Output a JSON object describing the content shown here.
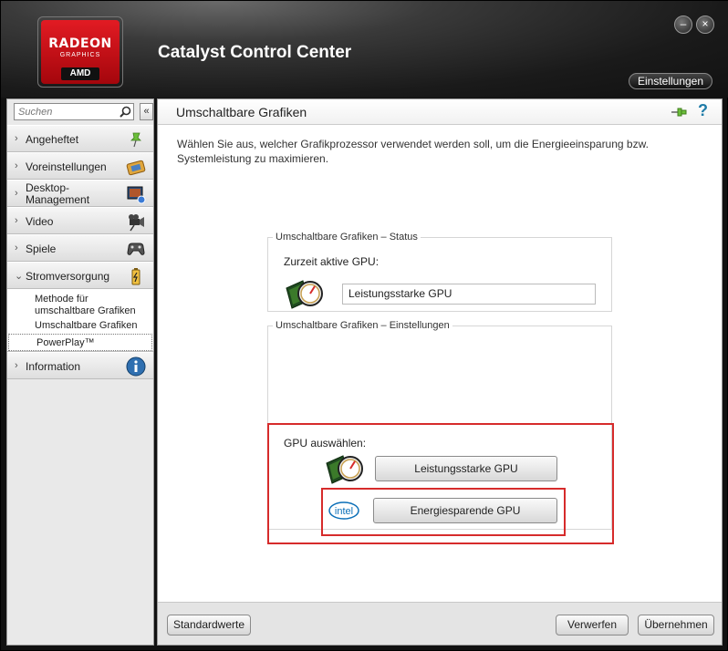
{
  "window": {
    "title": "Catalyst Control Center",
    "settings_label": "Einstellungen",
    "min_glyph": "–",
    "close_glyph": "×"
  },
  "logo": {
    "brand": "RADEON",
    "sub": "GRAPHICS",
    "maker": "AMD"
  },
  "sidebar": {
    "search_placeholder": "Suchen",
    "collapse_glyph": "«",
    "items": [
      {
        "label": "Angeheftet",
        "icon": "pin-icon"
      },
      {
        "label": "Voreinstellungen",
        "icon": "presets-icon"
      },
      {
        "label": "Desktop-\nManagement",
        "icon": "desktop-icon"
      },
      {
        "label": "Video",
        "icon": "video-camera-icon"
      },
      {
        "label": "Spiele",
        "icon": "gamepad-icon"
      },
      {
        "label": "Stromversorgung",
        "icon": "battery-icon",
        "expanded": true
      },
      {
        "label": "Information",
        "icon": "info-icon"
      }
    ],
    "subitems": [
      {
        "label": "Methode für umschaltbare Grafiken"
      },
      {
        "label": "Umschaltbare Grafiken"
      },
      {
        "label": "PowerPlay™"
      }
    ]
  },
  "main": {
    "title": "Umschaltbare Grafiken",
    "description": "Wählen Sie aus, welcher Grafikprozessor verwendet werden soll, um die Energieeinsparung bzw. Systemleistung zu maximieren.",
    "status": {
      "legend": "Umschaltbare Grafiken – Status",
      "active_label": "Zurzeit aktive GPU:",
      "active_value": "Leistungsstarke GPU"
    },
    "settings": {
      "legend": "Umschaltbare Grafiken – Einstellungen",
      "select_label": "GPU auswählen:",
      "performance_button": "Leistungsstarke GPU",
      "energy_button": "Energiesparende GPU",
      "intel_text": "intel"
    },
    "footer": {
      "default_button": "Standardwerte",
      "discard_button": "Verwerfen",
      "accept_button": "Übernehmen"
    }
  },
  "colors": {
    "highlight": "#d62b2b",
    "brand_red": "#e21b23",
    "help_blue": "#1f7ca8"
  }
}
